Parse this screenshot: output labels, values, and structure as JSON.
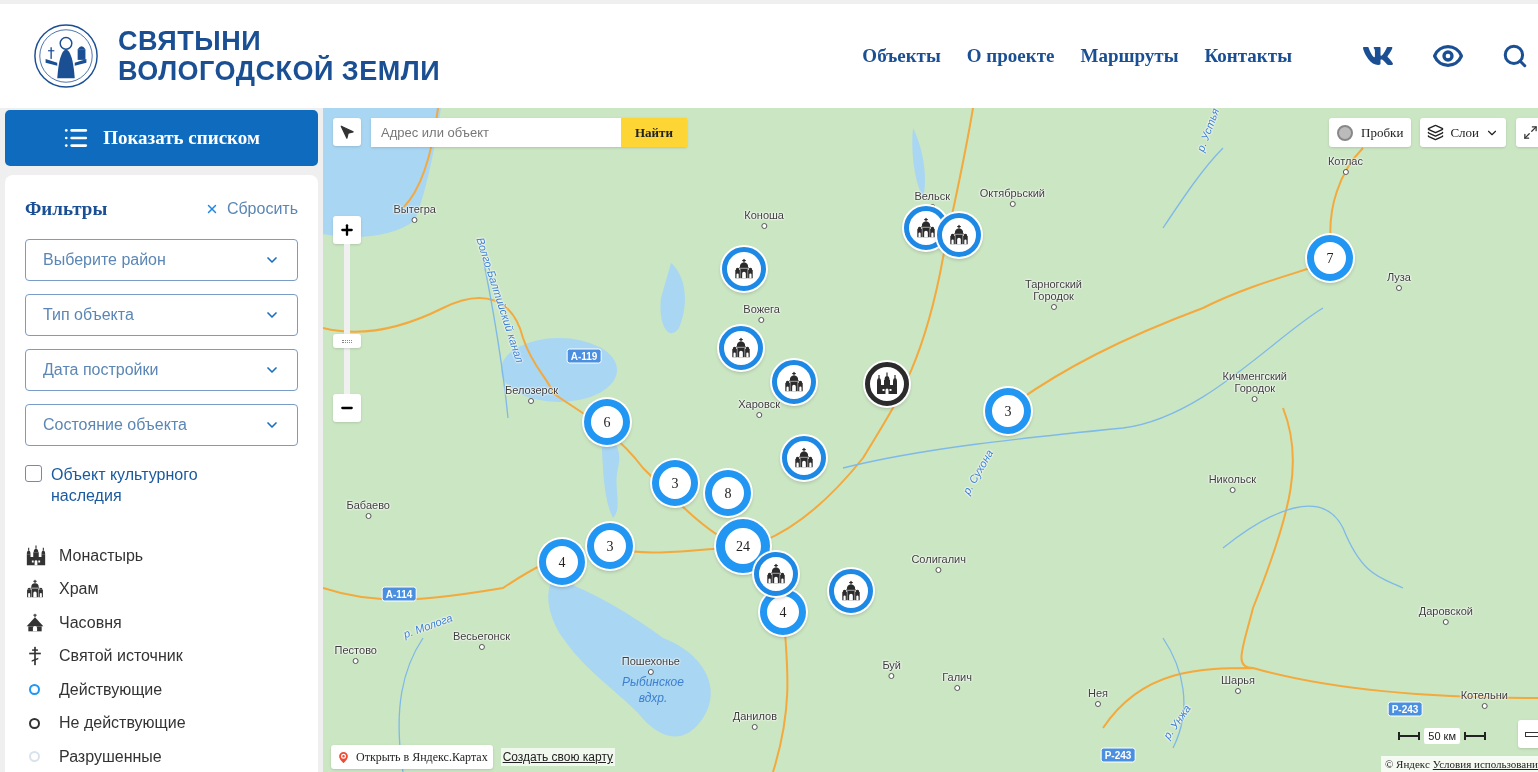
{
  "header": {
    "title_lines": [
      "СВЯТЫНИ",
      "ВОЛОГОДСКОЙ ЗЕМЛИ"
    ],
    "nav": [
      "Объекты",
      "О проекте",
      "Маршруты",
      "Контакты"
    ]
  },
  "sidebar": {
    "list_button": "Показать списком",
    "filters": {
      "title": "Фильтры",
      "reset": "Сбросить",
      "selects": [
        {
          "placeholder": "Выберите район"
        },
        {
          "placeholder": "Тип объекта"
        },
        {
          "placeholder": "Дата постройки"
        },
        {
          "placeholder": "Состояние объекта"
        }
      ],
      "checkbox": {
        "label": "Объект культурного наследия",
        "checked": false
      }
    },
    "legend": [
      {
        "kind": "monastery",
        "label": "Монастырь"
      },
      {
        "kind": "temple",
        "label": "Храм"
      },
      {
        "kind": "chapel",
        "label": "Часовня"
      },
      {
        "kind": "spring",
        "label": "Святой источник"
      },
      {
        "kind": "status",
        "label": "Действующие",
        "color": "#2196f3"
      },
      {
        "kind": "status",
        "label": "Не действующие",
        "color": "#333333"
      },
      {
        "kind": "status",
        "label": "Разрушенные",
        "color": "#d9e3ee"
      }
    ]
  },
  "map": {
    "search": {
      "placeholder": "Адрес или объект",
      "button": "Найти"
    },
    "traffic": "Пробки",
    "layers": "Слои",
    "labels": [
      {
        "kind": "city",
        "text": "Вельск"
      },
      {
        "kind": "city",
        "text": "Октябрьский"
      },
      {
        "kind": "river",
        "text": "р. Устья"
      },
      {
        "kind": "city",
        "text": "Котлас"
      },
      {
        "kind": "city",
        "text": "Вытегра"
      },
      {
        "kind": "city",
        "text": "Коноша"
      },
      {
        "kind": "river",
        "text": "Волго-Балтийский канал"
      },
      {
        "kind": "city",
        "text": "Луза"
      },
      {
        "kind": "city",
        "text": "Тарногский Городок"
      },
      {
        "kind": "city",
        "text": "Вожега"
      },
      {
        "kind": "road",
        "text": "А-119"
      },
      {
        "kind": "city",
        "text": "Белозерск"
      },
      {
        "kind": "city",
        "text": "Кичменгский Городок"
      },
      {
        "kind": "city",
        "text": "Харовск"
      },
      {
        "kind": "river",
        "text": "р. Сухона"
      },
      {
        "kind": "city",
        "text": "Никольск"
      },
      {
        "kind": "city",
        "text": "Бабаево"
      },
      {
        "kind": "city",
        "text": "Солигалич"
      },
      {
        "kind": "road",
        "text": "А-114"
      },
      {
        "kind": "river",
        "text": "р. Молога"
      },
      {
        "kind": "city",
        "text": "Даровской"
      },
      {
        "kind": "city",
        "text": "Весьегонск"
      },
      {
        "kind": "city",
        "text": "Пестово"
      },
      {
        "kind": "city",
        "text": "Пошехонье"
      },
      {
        "kind": "water",
        "text": "Рыбинское вдхр."
      },
      {
        "kind": "city",
        "text": "Буй"
      },
      {
        "kind": "city",
        "text": "Галич"
      },
      {
        "kind": "city",
        "text": "Шарья"
      },
      {
        "kind": "city",
        "text": "Нея"
      },
      {
        "kind": "city",
        "text": "Котельни"
      },
      {
        "kind": "road",
        "text": "Р-243"
      },
      {
        "kind": "river",
        "text": "р. Унжа"
      },
      {
        "kind": "city",
        "text": "Данилов"
      },
      {
        "kind": "road",
        "text": "Р-243"
      }
    ],
    "markers": [
      {
        "kind": "temple",
        "color": "#1e88e5"
      },
      {
        "kind": "temple",
        "color": "#1e88e5"
      },
      {
        "kind": "cluster",
        "count": "7",
        "color": "#2196f3"
      },
      {
        "kind": "temple",
        "color": "#1e88e5"
      },
      {
        "kind": "temple",
        "color": "#1e88e5"
      },
      {
        "kind": "temple",
        "color": "#1e88e5"
      },
      {
        "kind": "monastery",
        "color": "#2b2b2b"
      },
      {
        "kind": "cluster",
        "count": "3",
        "color": "#2196f3"
      },
      {
        "kind": "cluster",
        "count": "6",
        "color": "#2196f3"
      },
      {
        "kind": "temple",
        "color": "#1e88e5"
      },
      {
        "kind": "cluster",
        "count": "3",
        "color": "#2196f3"
      },
      {
        "kind": "cluster",
        "count": "8",
        "color": "#2196f3"
      },
      {
        "kind": "cluster",
        "count": "24",
        "color": "#2196f3"
      },
      {
        "kind": "cluster",
        "count": "3",
        "color": "#2196f3"
      },
      {
        "kind": "cluster",
        "count": "4",
        "color": "#2196f3"
      },
      {
        "kind": "cluster",
        "count": "4",
        "color": "#2196f3"
      },
      {
        "kind": "temple",
        "color": "#1e88e5"
      },
      {
        "kind": "temple",
        "color": "#1e88e5"
      }
    ],
    "open_link": "Открыть в Яндекс.Картах",
    "create_link": "Создать свою карту",
    "scale": "50 км",
    "copyright": "© Яндекс",
    "terms": "Условия использовани"
  }
}
